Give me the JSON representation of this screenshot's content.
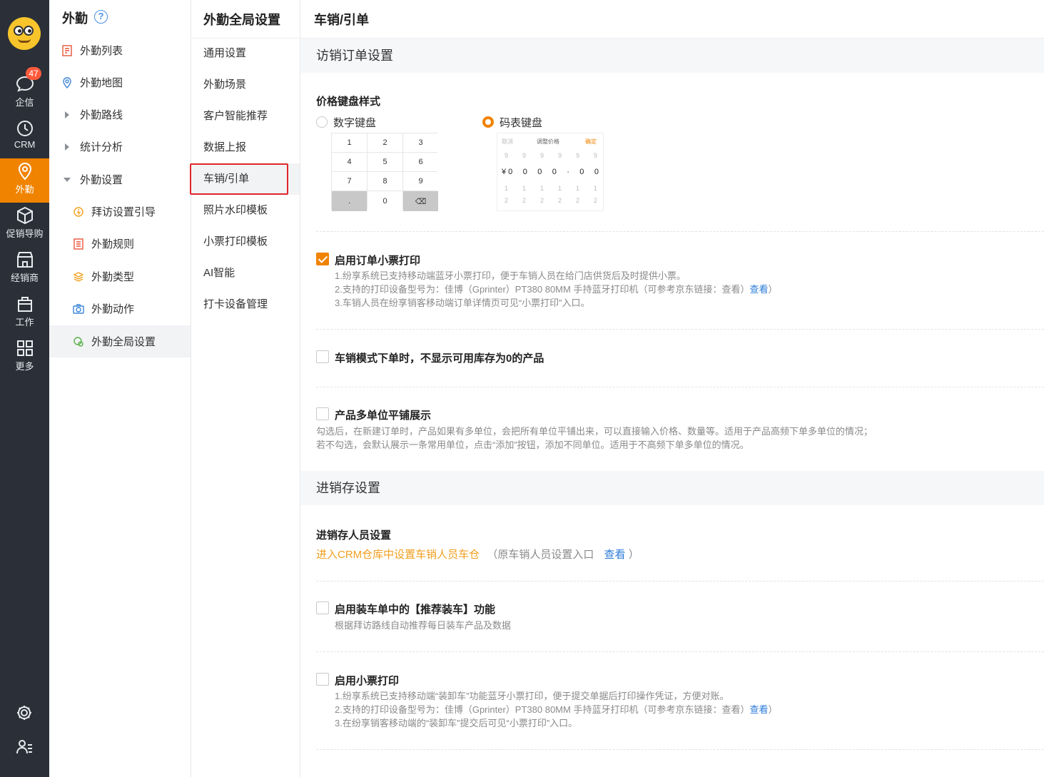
{
  "rail": {
    "items": [
      {
        "label": "企信",
        "badge": "47"
      },
      {
        "label": "CRM"
      },
      {
        "label": "外勤"
      },
      {
        "label": "促销导购"
      },
      {
        "label": "经销商"
      },
      {
        "label": "工作"
      },
      {
        "label": "更多"
      }
    ]
  },
  "nav": {
    "title": "外勤",
    "help": "?",
    "items": [
      {
        "label": "外勤列表"
      },
      {
        "label": "外勤地图"
      },
      {
        "label": "外勤路线"
      },
      {
        "label": "统计分析"
      },
      {
        "label": "外勤设置"
      },
      {
        "label": "拜访设置引导"
      },
      {
        "label": "外勤规则"
      },
      {
        "label": "外勤类型"
      },
      {
        "label": "外勤动作"
      },
      {
        "label": "外勤全局设置"
      }
    ]
  },
  "settings_nav": {
    "title": "外勤全局设置",
    "items": [
      {
        "label": "通用设置"
      },
      {
        "label": "外勤场景"
      },
      {
        "label": "客户智能推荐"
      },
      {
        "label": "数据上报"
      },
      {
        "label": "车销/引单"
      },
      {
        "label": "照片水印模板"
      },
      {
        "label": "小票打印模板"
      },
      {
        "label": "AI智能"
      },
      {
        "label": "打卡设备管理"
      }
    ]
  },
  "main": {
    "title": "车销/引单",
    "visit_section": {
      "title": "访销订单设置",
      "price_keyboard": {
        "label": "价格键盘样式",
        "options": [
          "数字键盘",
          "码表键盘"
        ],
        "selected": "码表键盘",
        "numeric_keys": [
          "1",
          "2",
          "3",
          "4",
          "5",
          "6",
          "7",
          "8",
          "9",
          ".",
          "0",
          "⌫"
        ],
        "code_header": {
          "cancel": "取消",
          "title": "调整价格",
          "ok": "确定"
        },
        "code_rows": {
          "top": [
            "9",
            "9",
            "9",
            "9",
            "9",
            "9"
          ],
          "value": [
            "¥ 0",
            "0",
            "0",
            "0",
            "·",
            "0",
            "0"
          ],
          "r1": [
            "1",
            "1",
            "1",
            "1",
            "1",
            "1"
          ],
          "r2": [
            "2",
            "2",
            "2",
            "2",
            "2",
            "2"
          ]
        }
      },
      "order_receipt": {
        "label": "启用订单小票打印",
        "checked": true,
        "lines": [
          "1.纷享系统已支持移动端蓝牙小票打印，便于车销人员在给门店供货后及时提供小票。",
          "2.支持的打印设备型号为：佳博（Gprinter）PT380 80MM 手持蓝牙打印机（可参考京东链接：查看）",
          "3.车销人员在纷享销客移动端订单详情页可见“小票打印”入口。"
        ],
        "link": "查看"
      },
      "hide_zero_stock": {
        "label": "车销模式下单时，不显示可用库存为0的产品",
        "checked": false
      },
      "multi_unit": {
        "label": "产品多单位平铺展示",
        "checked": false,
        "lines": [
          "勾选后，在新建订单时，产品如果有多单位，会把所有单位平铺出来，可以直接输入价格、数量等。适用于产品高频下单多单位的情况；",
          "若不勾选，会默认展示一条常用单位，点击“添加”按钮，添加不同单位。适用于不高频下单多单位的情况。"
        ]
      }
    },
    "inventory_section": {
      "title": "进销存设置",
      "staff": {
        "label": "进销存人员设置",
        "link_text": "进入CRM仓库中设置车销人员车仓",
        "note_prefix": "（原车销人员设置入口",
        "note_link": "查看",
        "note_suffix": "）"
      },
      "recommend_loading": {
        "label": "启用装车单中的【推荐装车】功能",
        "checked": false,
        "desc": "根据拜访路线自动推荐每日装车产品及数据"
      },
      "receipt_print": {
        "label": "启用小票打印",
        "checked": false,
        "lines": [
          "1.纷享系统已支持移动端“装卸车”功能蓝牙小票打印，便于提交单据后打印操作凭证，方便对账。",
          "2.支持的打印设备型号为：佳博（Gprinter）PT380 80MM 手持蓝牙打印机（可参考京东链接：查看）",
          "3.在纷享销客移动端的“装卸车”提交后可见“小票打印”入口。"
        ],
        "link": "查看"
      }
    }
  },
  "colors": {
    "accent": "#f08300",
    "rail_bg": "#2b2f38",
    "link": "#2a7ad8",
    "highlight_box": "#e0262b"
  }
}
